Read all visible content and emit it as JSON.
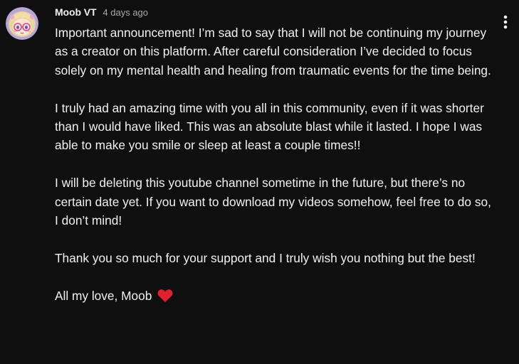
{
  "post": {
    "author": "Moob VT",
    "timestamp": "4 days ago",
    "avatar_icon": "anime-girl-avatar",
    "menu_icon": "more-vertical-icon",
    "paragraphs": [
      "Important announcement! I’m sad to say that I will not be continuing my journey as a creator on this platform. After careful consideration I’ve decided to focus solely on my mental health and healing from traumatic events for the time being.",
      "I truly had an amazing time with you all in this community, even if it was shorter than I would have liked. This was an absolute blast while it lasted. I hope I was able to make you smile or sleep at least a couple times!!",
      "I will be deleting this youtube channel sometime in the future, but there’s no certain date yet. If you want to download my videos somehow, feel free to do so, I don’t mind!",
      "Thank you so much for your support and I truly wish you nothing but the best!"
    ],
    "signoff": "All my love, Moob",
    "signoff_icon": "red-heart-icon"
  },
  "colors": {
    "background": "#0f0f0f",
    "text": "#f1f1f1",
    "secondary_text": "#aaaaaa",
    "heart": "#e0202a"
  }
}
